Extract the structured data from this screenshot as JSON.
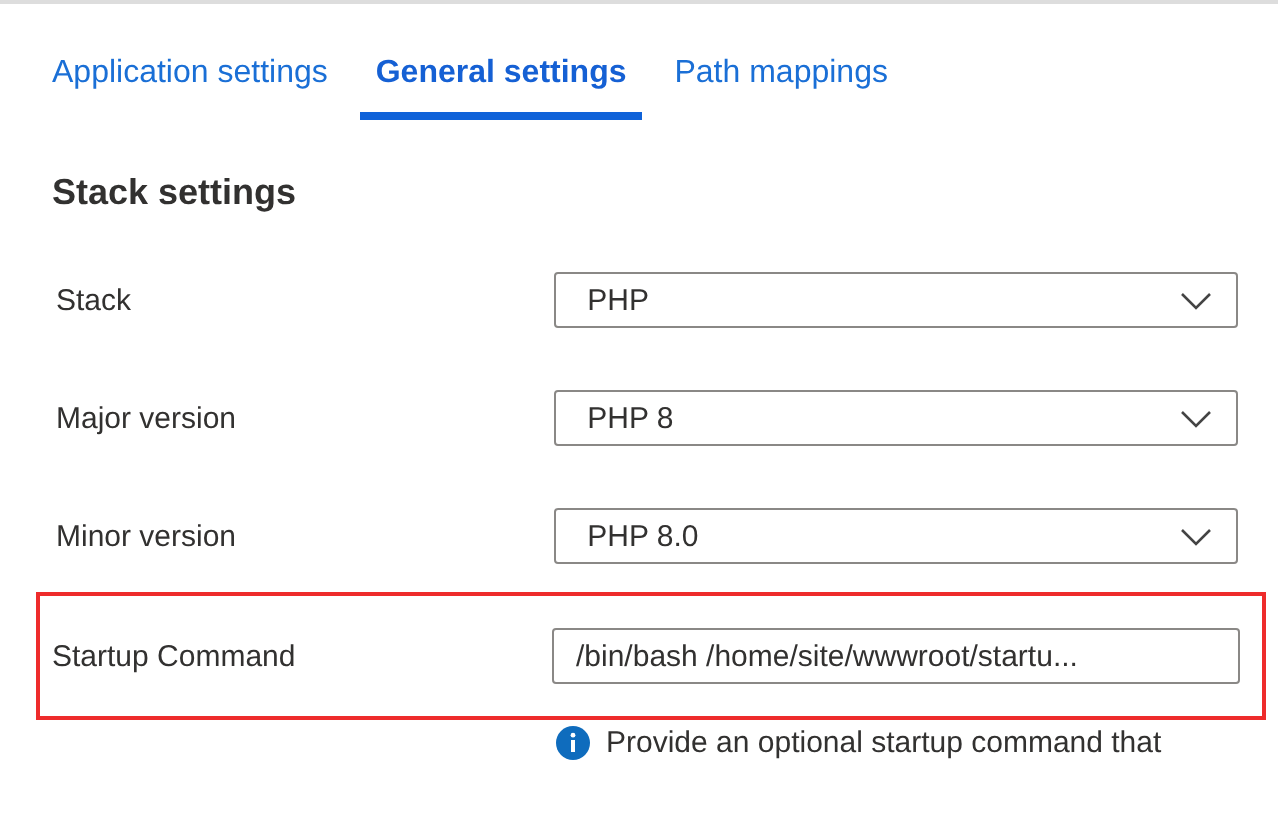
{
  "tabs": [
    {
      "label": "Application settings",
      "selected": false
    },
    {
      "label": "General settings",
      "selected": true
    },
    {
      "label": "Path mappings",
      "selected": false
    }
  ],
  "section": {
    "title": "Stack settings"
  },
  "fields": [
    {
      "label": "Stack",
      "kind": "dropdown",
      "value": "PHP",
      "highlighted": false
    },
    {
      "label": "Major version",
      "kind": "dropdown",
      "value": "PHP 8",
      "highlighted": false
    },
    {
      "label": "Minor version",
      "kind": "dropdown",
      "value": "PHP 8.0",
      "highlighted": false
    },
    {
      "label": "Startup Command",
      "kind": "text",
      "value": "/bin/bash /home/site/wwwroot/startu...",
      "highlighted": true,
      "help": "Provide an optional startup command that"
    }
  ]
}
